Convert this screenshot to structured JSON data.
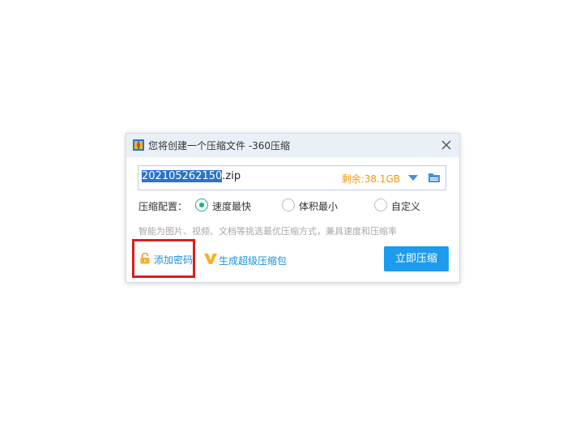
{
  "dialog": {
    "title": "您将创建一个压缩文件 -360压缩",
    "filename_selected": "202105262150",
    "filename_ext": ".zip",
    "remaining_space": "剩余:38.1GB",
    "config_label": "压缩配置：",
    "options": [
      {
        "label": "速度最快",
        "checked": true
      },
      {
        "label": "体积最小",
        "checked": false
      },
      {
        "label": "自定义",
        "checked": false
      }
    ],
    "hint": "智能为图片、视频、文档等挑选最优压缩方式，兼具速度和压缩率",
    "add_password": "添加密码",
    "super_compress": "生成超级压缩包",
    "compress_button": "立即压缩"
  },
  "colors": {
    "accent": "#1d9cee",
    "link": "#1c8fd8",
    "space_text": "#f0960e",
    "radio_checked": "#1fb07a",
    "highlight": "#d81e1e",
    "selection": "#2b73c9"
  },
  "icons": {
    "app": "360zip-app-icon",
    "close": "close-icon",
    "dropdown": "chevron-down-icon",
    "folder": "folder-icon",
    "lock": "lock-icon",
    "vip": "vip-v-icon"
  }
}
